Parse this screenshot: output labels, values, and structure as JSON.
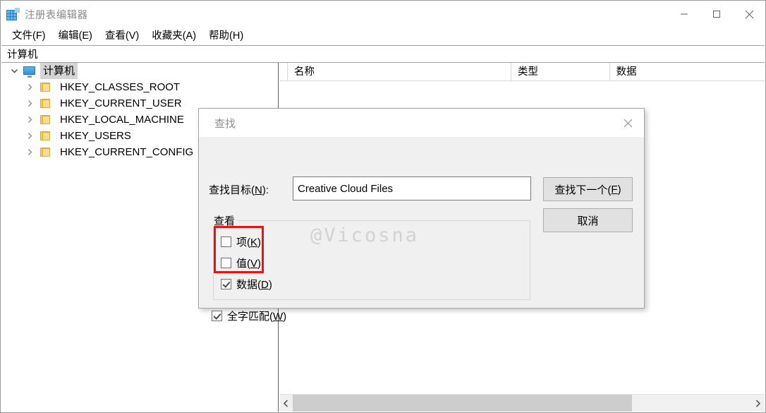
{
  "window": {
    "title": "注册表编辑器",
    "icon": "registry-editor-icon",
    "controls": {
      "minimize": "minimize-icon",
      "maximize": "maximize-icon",
      "close": "close-icon"
    }
  },
  "menubar": {
    "items": [
      {
        "label": "文件(F)"
      },
      {
        "label": "编辑(E)"
      },
      {
        "label": "查看(V)"
      },
      {
        "label": "收藏夹(A)"
      },
      {
        "label": "帮助(H)"
      }
    ]
  },
  "address_bar": {
    "value": "计算机"
  },
  "tree": {
    "root": {
      "label": "计算机",
      "icon": "monitor-icon",
      "expanded": true,
      "selected": true
    },
    "children": [
      {
        "label": "HKEY_CLASSES_ROOT",
        "icon": "folder-icon",
        "expanded": false
      },
      {
        "label": "HKEY_CURRENT_USER",
        "icon": "folder-icon",
        "expanded": false
      },
      {
        "label": "HKEY_LOCAL_MACHINE",
        "icon": "folder-icon",
        "expanded": false
      },
      {
        "label": "HKEY_USERS",
        "icon": "folder-icon",
        "expanded": false
      },
      {
        "label": "HKEY_CURRENT_CONFIG",
        "icon": "folder-icon",
        "expanded": false
      }
    ]
  },
  "list": {
    "columns": [
      {
        "label": "名称"
      },
      {
        "label": "类型"
      },
      {
        "label": "数据"
      }
    ],
    "rows": []
  },
  "scrollbar": {
    "left_arrow": "chevron-left-icon",
    "right_arrow": "chevron-right-icon"
  },
  "find_dialog": {
    "title": "查找",
    "close_icon": "close-icon",
    "find_label": "查找目标(N):",
    "find_value": "Creative Cloud Files",
    "find_placeholder": "",
    "buttons": {
      "find_next": "查找下一个(F)",
      "cancel": "取消"
    },
    "group": {
      "legend": "查看",
      "checkboxes": [
        {
          "label": "项(K)",
          "checked": false
        },
        {
          "label": "值(V)",
          "checked": false
        },
        {
          "label": "数据(D)",
          "checked": true
        }
      ]
    },
    "match_whole": {
      "label": "全字匹配(W)",
      "checked": true
    },
    "watermark": "@Vicosna",
    "highlight_color": "#ee1111"
  }
}
